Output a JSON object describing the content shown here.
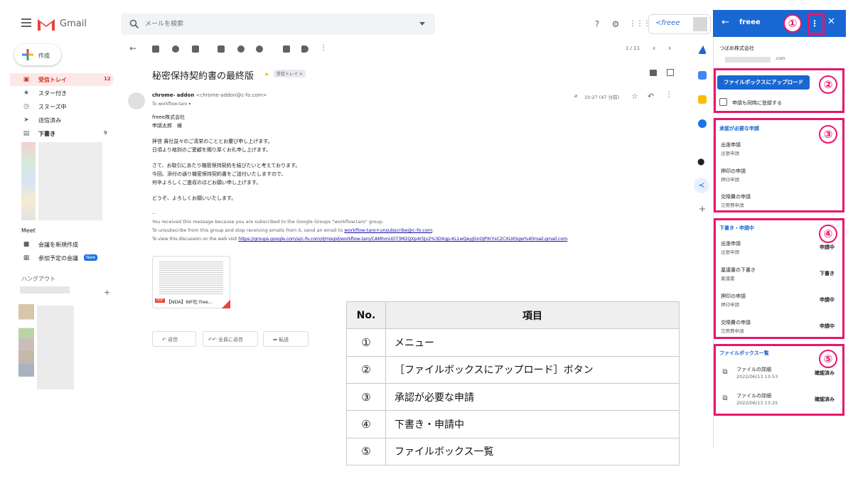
{
  "gmail": {
    "logo_text": "Gmail",
    "search_placeholder": "メールを検索",
    "compose_label": "作成",
    "nav": [
      {
        "label": "受信トレイ",
        "count": "12",
        "icon": "inbox-icon"
      },
      {
        "label": "スター付き",
        "count": "",
        "icon": "star-icon"
      },
      {
        "label": "スヌーズ中",
        "count": "",
        "icon": "clock-icon"
      },
      {
        "label": "送信済み",
        "count": "",
        "icon": "send-icon"
      },
      {
        "label": "下書き",
        "count": "9",
        "icon": "draft-icon"
      }
    ],
    "meet": {
      "title": "Meet",
      "new_meeting": "会議を新規作成",
      "join_meeting": "参加予定の会議",
      "new_badge": "New"
    },
    "hangouts_title": "ハングアウト",
    "pager": "1 / 11",
    "freee_chip": "≺freee"
  },
  "mail": {
    "subject": "秘密保持契約書の最終版",
    "label": "受信トレイ ×",
    "sender_name": "chrome- addon",
    "sender_email": "<chrome-addon@c-fo.com>",
    "to_line": "To workflow-taro ▾",
    "time": "10:27 (47 分前)",
    "body": [
      "freee株式会社",
      "申請太郎　様",
      "拝啓 貴社益々のご清栄のこととお慶び申し上げます。",
      "日頃より格別のご愛顧を賜り厚くお礼申し上げます。",
      "さて、お取引にあたり機密保持契約を結びたいと考えております。",
      "今回、添付の通り機密保持契約書をご送付いたしますので、",
      "何卒よろしくご査収のほどお願い申し上げます。",
      "どうぞ、よろしくお願いいたします。"
    ],
    "footer": {
      "dash": "--",
      "line1": "You received this message because you are subscribed to the Google Groups \"workflow.taro\" group.",
      "line2_prefix": "To unsubscribe from this group and stop receiving emails from it, send an email to ",
      "line2_link": "workflow-taro+unsubscribe@c-fo.com",
      "line2_suffix": ".",
      "line3_prefix": "To view this discussion on the web visit ",
      "line3_link": "https://groups.google.com/a/c-fo.com/d/msgid/workflow-taro/CAMhmUO73M2QXp4r5Jv2%3DXgp-KL1wQeyJGnOJPXrYsC2CXUXSgw%40mail.gmail.com",
      "line3_suffix": "."
    },
    "attachment": {
      "type": "PDF",
      "name": "【NDA】WF社:free..."
    },
    "actions": {
      "reply": "返信",
      "reply_all": "全員に返信",
      "forward": "転送"
    }
  },
  "freee": {
    "title": "freee",
    "company": "つばめ株式会社",
    "email_suffix": ".com",
    "upload_button": "ファイルボックスにアップロード",
    "checkbox_label": "申請も同時に登録する",
    "approval": {
      "title": "承認が必要な申請",
      "items": [
        {
          "name": "出張申請",
          "sub": "出張申請"
        },
        {
          "name": "押印の申請",
          "sub": "押印申請"
        },
        {
          "name": "交際費の申請",
          "sub": "交際費申請"
        }
      ]
    },
    "drafts": {
      "title": "下書き・申請中",
      "items": [
        {
          "name": "出張申請",
          "sub": "出張申請",
          "status": "申請中"
        },
        {
          "name": "稟議書の下書き",
          "sub": "稟議書",
          "status": "下書き"
        },
        {
          "name": "押印の申請",
          "sub": "押印申請",
          "status": "申請中"
        },
        {
          "name": "交際費の申請",
          "sub": "交際費申請",
          "status": "申請中"
        }
      ]
    },
    "filebox": {
      "title": "ファイルボックス一覧",
      "items": [
        {
          "name": "ファイルの詳細",
          "date": "2022/06/13 13:53",
          "status": "確認済み"
        },
        {
          "name": "ファイルの詳細",
          "date": "2022/06/13 13:25",
          "status": "確認済み"
        }
      ]
    }
  },
  "callouts": [
    "①",
    "②",
    "③",
    "④",
    "⑤"
  ],
  "legend": {
    "headers": [
      "No.",
      "項目"
    ],
    "rows": [
      {
        "no": "①",
        "item": "メニュー"
      },
      {
        "no": "②",
        "item": "［ファイルボックスにアップロード］ボタン"
      },
      {
        "no": "③",
        "item": "承認が必要な申請"
      },
      {
        "no": "④",
        "item": "下書き・申請中"
      },
      {
        "no": "⑤",
        "item": "ファイルボックス一覧"
      }
    ]
  },
  "colors": {
    "accent": "#1967d2",
    "callout": "#e6176a",
    "inbox_active": "#fce8e6",
    "gmail_red": "#ea4335"
  }
}
